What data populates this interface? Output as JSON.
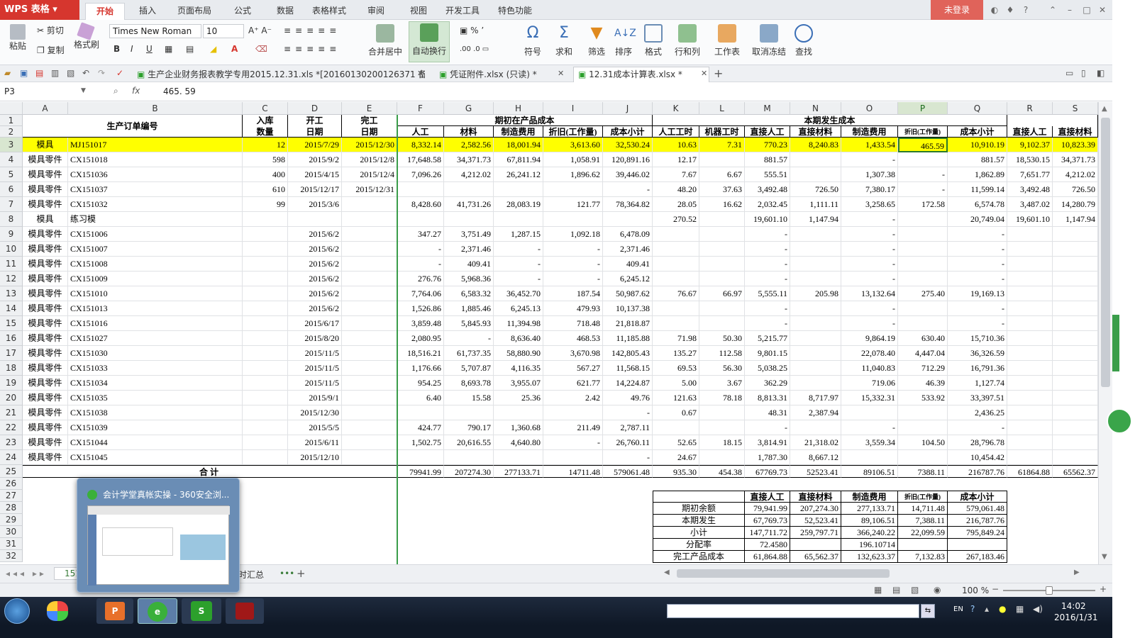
{
  "app": {
    "title": "WPS 表格",
    "login": "未登录"
  },
  "ribbon_tabs": [
    "开始",
    "插入",
    "页面布局",
    "公式",
    "数据",
    "表格样式",
    "审阅",
    "视图",
    "开发工具",
    "特色功能"
  ],
  "ribbon": {
    "paste": "粘贴",
    "cut": "剪切",
    "copy": "复制",
    "format_painter": "格式刷",
    "font": "Times New Roman",
    "font_size": "10",
    "bold": "B",
    "italic": "I",
    "underline": "U",
    "merge_center": "合并居中",
    "wrap_text": "自动换行",
    "symbol": "符号",
    "sum": "求和",
    "filter": "筛选",
    "sort": "排序",
    "format": "格式",
    "row_col": "行和列",
    "worksheet": "工作表",
    "freeze": "取消冻结",
    "find": "查找"
  },
  "doc_tabs": [
    "生产企业财务报表教学专用2015.12.31.xls *[20160130200126371 备份]",
    "凭证附件.xlsx (只读) *",
    "12.31成本计算表.xlsx *"
  ],
  "formula": {
    "name_box": "P3",
    "fx": "fx",
    "value": "465. 59"
  },
  "columns": [
    "A",
    "B",
    "C",
    "D",
    "E",
    "F",
    "G",
    "H",
    "I",
    "J",
    "K",
    "L",
    "M",
    "N",
    "O",
    "P",
    "Q",
    "R",
    "S"
  ],
  "header": {
    "order_no": "生产订单编号",
    "in_qty": "入库",
    "in_qty2": "数量",
    "start": "开工",
    "start2": "日期",
    "finish": "完工",
    "finish2": "日期",
    "opening_group": "期初在产品成本",
    "current_group": "本期发生成本",
    "labor": "人工",
    "material": "材料",
    "overhead": "制造费用",
    "depr": "折旧(工作量)",
    "subtotal": "成本小计",
    "labor_hours": "人工工时",
    "machine_hours": "机器工时",
    "direct_labor": "直接人工",
    "direct_material": "直接材料",
    "overhead2": "制造费用",
    "depr2": "折旧(工作量)",
    "subtotal2": "成本小计",
    "direct_labor3": "直接人工",
    "direct_material3": "直接材料"
  },
  "rows": [
    {
      "a": "模具",
      "b": "MJ151017",
      "c": "12",
      "d": "2015/7/29",
      "e": "2015/12/30",
      "f": "8,332.14",
      "g": "2,582.56",
      "h": "18,001.94",
      "i": "3,613.60",
      "j": "32,530.24",
      "k": "10.63",
      "l": "7.31",
      "m": "770.23",
      "n": "8,240.83",
      "o": "1,433.54",
      "p": "465.59",
      "q": "10,910.19",
      "r": "9,102.37",
      "s": "10,823.39"
    },
    {
      "a": "模具零件",
      "b": "CX151018",
      "c": "598",
      "d": "2015/9/2",
      "e": "2015/12/8",
      "f": "17,648.58",
      "g": "34,371.73",
      "h": "67,811.94",
      "i": "1,058.91",
      "j": "120,891.16",
      "k": "12.17",
      "l": "",
      "m": "881.57",
      "n": "",
      "o": "-",
      "p": "",
      "q": "881.57",
      "r": "18,530.15",
      "s": "34,371.73"
    },
    {
      "a": "模具零件",
      "b": "CX151036",
      "c": "400",
      "d": "2015/4/15",
      "e": "2015/12/4",
      "f": "7,096.26",
      "g": "4,212.02",
      "h": "26,241.12",
      "i": "1,896.62",
      "j": "39,446.02",
      "k": "7.67",
      "l": "6.67",
      "m": "555.51",
      "n": "",
      "o": "1,307.38",
      "p": "-",
      "q": "1,862.89",
      "r": "7,651.77",
      "s": "4,212.02"
    },
    {
      "a": "模具零件",
      "b": "CX151037",
      "c": "610",
      "d": "2015/12/17",
      "e": "2015/12/31",
      "f": "",
      "g": "",
      "h": "",
      "i": "",
      "j": "-",
      "k": "48.20",
      "l": "37.63",
      "m": "3,492.48",
      "n": "726.50",
      "o": "7,380.17",
      "p": "-",
      "q": "11,599.14",
      "r": "3,492.48",
      "s": "726.50"
    },
    {
      "a": "模具零件",
      "b": "CX151032",
      "c": "99",
      "d": "2015/3/6",
      "e": "",
      "f": "8,428.60",
      "g": "41,731.26",
      "h": "28,083.19",
      "i": "121.77",
      "j": "78,364.82",
      "k": "28.05",
      "l": "16.62",
      "m": "2,032.45",
      "n": "1,111.11",
      "o": "3,258.65",
      "p": "172.58",
      "q": "6,574.78",
      "r": "3,487.02",
      "s": "14,280.79"
    },
    {
      "a": "模具",
      "b": "练习模",
      "c": "",
      "d": "",
      "e": "",
      "f": "",
      "g": "",
      "h": "",
      "i": "",
      "j": "",
      "k": "270.52",
      "l": "",
      "m": "19,601.10",
      "n": "1,147.94",
      "o": "-",
      "p": "",
      "q": "20,749.04",
      "r": "19,601.10",
      "s": "1,147.94"
    },
    {
      "a": "模具零件",
      "b": "CX151006",
      "c": "",
      "d": "2015/6/2",
      "e": "",
      "f": "347.27",
      "g": "3,751.49",
      "h": "1,287.15",
      "i": "1,092.18",
      "j": "6,478.09",
      "k": "",
      "l": "",
      "m": "-",
      "n": "",
      "o": "-",
      "p": "",
      "q": "-",
      "r": "",
      "s": ""
    },
    {
      "a": "模具零件",
      "b": "CX151007",
      "c": "",
      "d": "2015/6/2",
      "e": "",
      "f": "-",
      "g": "2,371.46",
      "h": "-",
      "i": "-",
      "j": "2,371.46",
      "k": "",
      "l": "",
      "m": "-",
      "n": "",
      "o": "-",
      "p": "",
      "q": "-",
      "r": "",
      "s": ""
    },
    {
      "a": "模具零件",
      "b": "CX151008",
      "c": "",
      "d": "2015/6/2",
      "e": "",
      "f": "-",
      "g": "409.41",
      "h": "-",
      "i": "-",
      "j": "409.41",
      "k": "",
      "l": "",
      "m": "-",
      "n": "",
      "o": "-",
      "p": "",
      "q": "-",
      "r": "",
      "s": ""
    },
    {
      "a": "模具零件",
      "b": "CX151009",
      "c": "",
      "d": "2015/6/2",
      "e": "",
      "f": "276.76",
      "g": "5,968.36",
      "h": "-",
      "i": "-",
      "j": "6,245.12",
      "k": "",
      "l": "",
      "m": "-",
      "n": "",
      "o": "-",
      "p": "",
      "q": "-",
      "r": "",
      "s": ""
    },
    {
      "a": "模具零件",
      "b": "CX151010",
      "c": "",
      "d": "2015/6/2",
      "e": "",
      "f": "7,764.06",
      "g": "6,583.32",
      "h": "36,452.70",
      "i": "187.54",
      "j": "50,987.62",
      "k": "76.67",
      "l": "66.97",
      "m": "5,555.11",
      "n": "205.98",
      "o": "13,132.64",
      "p": "275.40",
      "q": "19,169.13",
      "r": "",
      "s": ""
    },
    {
      "a": "模具零件",
      "b": "CX151013",
      "c": "",
      "d": "2015/6/2",
      "e": "",
      "f": "1,526.86",
      "g": "1,885.46",
      "h": "6,245.13",
      "i": "479.93",
      "j": "10,137.38",
      "k": "",
      "l": "",
      "m": "-",
      "n": "",
      "o": "-",
      "p": "",
      "q": "-",
      "r": "",
      "s": ""
    },
    {
      "a": "模具零件",
      "b": "CX151016",
      "c": "",
      "d": "2015/6/17",
      "e": "",
      "f": "3,859.48",
      "g": "5,845.93",
      "h": "11,394.98",
      "i": "718.48",
      "j": "21,818.87",
      "k": "",
      "l": "",
      "m": "-",
      "n": "",
      "o": "-",
      "p": "",
      "q": "-",
      "r": "",
      "s": ""
    },
    {
      "a": "模具零件",
      "b": "CX151027",
      "c": "",
      "d": "2015/8/20",
      "e": "",
      "f": "2,080.95",
      "g": "-",
      "h": "8,636.40",
      "i": "468.53",
      "j": "11,185.88",
      "k": "71.98",
      "l": "50.30",
      "m": "5,215.77",
      "n": "",
      "o": "9,864.19",
      "p": "630.40",
      "q": "15,710.36",
      "r": "",
      "s": ""
    },
    {
      "a": "模具零件",
      "b": "CX151030",
      "c": "",
      "d": "2015/11/5",
      "e": "",
      "f": "18,516.21",
      "g": "61,737.35",
      "h": "58,880.90",
      "i": "3,670.98",
      "j": "142,805.43",
      "k": "135.27",
      "l": "112.58",
      "m": "9,801.15",
      "n": "",
      "o": "22,078.40",
      "p": "4,447.04",
      "q": "36,326.59",
      "r": "",
      "s": ""
    },
    {
      "a": "模具零件",
      "b": "CX151033",
      "c": "",
      "d": "2015/11/5",
      "e": "",
      "f": "1,176.66",
      "g": "5,707.87",
      "h": "4,116.35",
      "i": "567.27",
      "j": "11,568.15",
      "k": "69.53",
      "l": "56.30",
      "m": "5,038.25",
      "n": "",
      "o": "11,040.83",
      "p": "712.29",
      "q": "16,791.36",
      "r": "",
      "s": ""
    },
    {
      "a": "模具零件",
      "b": "CX151034",
      "c": "",
      "d": "2015/11/5",
      "e": "",
      "f": "954.25",
      "g": "8,693.78",
      "h": "3,955.07",
      "i": "621.77",
      "j": "14,224.87",
      "k": "5.00",
      "l": "3.67",
      "m": "362.29",
      "n": "",
      "o": "719.06",
      "p": "46.39",
      "q": "1,127.74",
      "r": "",
      "s": ""
    },
    {
      "a": "模具零件",
      "b": "CX151035",
      "c": "",
      "d": "2015/9/1",
      "e": "",
      "f": "6.40",
      "g": "15.58",
      "h": "25.36",
      "i": "2.42",
      "j": "49.76",
      "k": "121.63",
      "l": "78.18",
      "m": "8,813.31",
      "n": "8,717.97",
      "o": "15,332.31",
      "p": "533.92",
      "q": "33,397.51",
      "r": "",
      "s": ""
    },
    {
      "a": "模具零件",
      "b": "CX151038",
      "c": "",
      "d": "2015/12/30",
      "e": "",
      "f": "",
      "g": "",
      "h": "",
      "i": "",
      "j": "-",
      "k": "0.67",
      "l": "",
      "m": "48.31",
      "n": "2,387.94",
      "o": "",
      "p": "",
      "q": "2,436.25",
      "r": "",
      "s": ""
    },
    {
      "a": "模具零件",
      "b": "CX151039",
      "c": "",
      "d": "2015/5/5",
      "e": "",
      "f": "424.77",
      "g": "790.17",
      "h": "1,360.68",
      "i": "211.49",
      "j": "2,787.11",
      "k": "",
      "l": "",
      "m": "-",
      "n": "",
      "o": "-",
      "p": "",
      "q": "-",
      "r": "",
      "s": ""
    },
    {
      "a": "模具零件",
      "b": "CX151044",
      "c": "",
      "d": "2015/6/11",
      "e": "",
      "f": "1,502.75",
      "g": "20,616.55",
      "h": "4,640.80",
      "i": "-",
      "j": "26,760.11",
      "k": "52.65",
      "l": "18.15",
      "m": "3,814.91",
      "n": "21,318.02",
      "o": "3,559.34",
      "p": "104.50",
      "q": "28,796.78",
      "r": "",
      "s": ""
    },
    {
      "a": "模具零件",
      "b": "CX151045",
      "c": "",
      "d": "2015/12/10",
      "e": "",
      "f": "",
      "g": "",
      "h": "",
      "i": "",
      "j": "-",
      "k": "24.67",
      "l": "",
      "m": "1,787.30",
      "n": "8,667.12",
      "o": "",
      "p": "",
      "q": "10,454.42",
      "r": "",
      "s": ""
    }
  ],
  "total_row": {
    "label": "合  计",
    "f": "79941.99",
    "g": "207274.30",
    "h": "277133.71",
    "i": "14711.48",
    "j": "579061.48",
    "k": "935.30",
    "l": "454.38",
    "m": "67769.73",
    "n": "52523.41",
    "o": "89106.51",
    "p": "7388.11",
    "q": "216787.76",
    "r": "61864.88",
    "s": "65562.37"
  },
  "summary": {
    "headers": [
      "直接人工",
      "直接材料",
      "制造费用",
      "折旧(工作量)",
      "成本小计"
    ],
    "rows": [
      {
        "label": "期初余额",
        "vals": [
          "79,941.99",
          "207,274.30",
          "277,133.71",
          "14,711.48",
          "579,061.48"
        ]
      },
      {
        "label": "本期发生",
        "vals": [
          "67,769.73",
          "52,523.41",
          "89,106.51",
          "7,388.11",
          "216,787.76"
        ]
      },
      {
        "label": "小计",
        "vals": [
          "147,711.72",
          "259,797.71",
          "366,240.22",
          "22,099.59",
          "795,849.24"
        ]
      },
      {
        "label": "分配率",
        "vals": [
          "72.4580",
          "",
          "196.10714",
          "",
          ""
        ]
      },
      {
        "label": "完工产品成本",
        "vals": [
          "61,864.88",
          "65,562.37",
          "132,623.37",
          "7,132.83",
          "267,183.46"
        ]
      }
    ]
  },
  "sheet_tabs": [
    "151",
    "时汇总"
  ],
  "popup": {
    "title": "会计学堂真帐实操 - 360安全浏..."
  },
  "status": {
    "zoom": "100 %"
  },
  "taskbar": {
    "time": "14:02",
    "date": "2016/1/31",
    "lang": "EN"
  }
}
